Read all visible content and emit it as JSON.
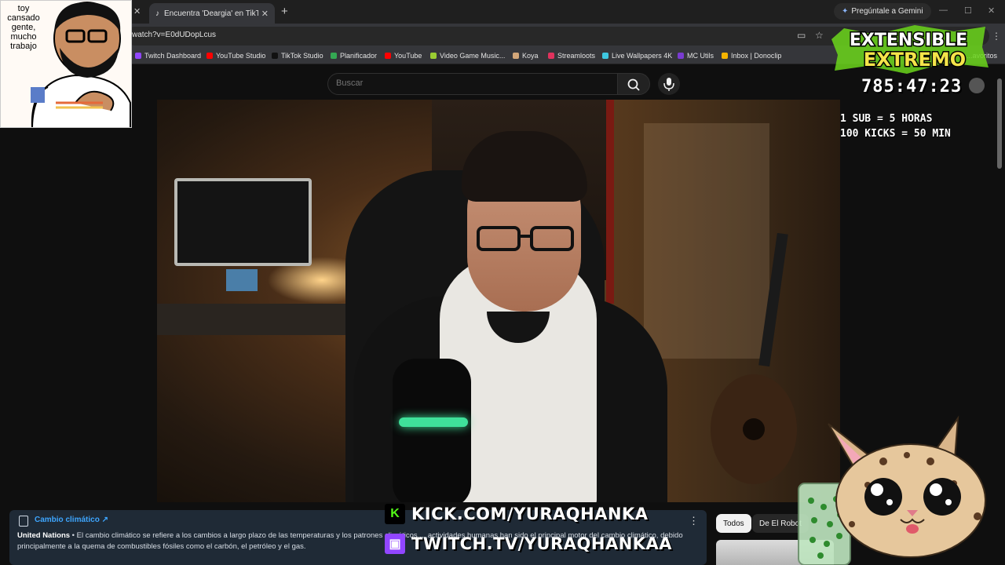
{
  "browser": {
    "active_tab_title": "Encuentra 'Deargia' en TikTok |",
    "gemini_label": "Pregúntale a Gemini",
    "url_fragment": "watch?v=E0dUDopLcus"
  },
  "bookmarks": [
    {
      "label": "Twitch Dashboard",
      "color": "#9146ff"
    },
    {
      "label": "YouTube Studio",
      "color": "#ff0000"
    },
    {
      "label": "TikTok Studio",
      "color": "#111111"
    },
    {
      "label": "Planificador",
      "color": "#34a853"
    },
    {
      "label": "YouTube",
      "color": "#ff0000"
    },
    {
      "label": "Video Game Music...",
      "color": "#9acd32"
    },
    {
      "label": "Koya",
      "color": "#d2a679"
    },
    {
      "label": "Streamloots",
      "color": "#e0325d"
    },
    {
      "label": "Live Wallpapers 4K",
      "color": "#3ec7e0"
    },
    {
      "label": "MC Utils",
      "color": "#7a3bd1"
    },
    {
      "label": "Inbox | Donoclip",
      "color": "#f5b400"
    }
  ],
  "bookmarks_end": "...avoritos",
  "youtube": {
    "search_placeholder": "Buscar"
  },
  "overlay": {
    "art_caption": "toy cansado gente, mucho trabajo",
    "logo_line1": "EXTENSIBLE",
    "logo_line2": "EXTREMO",
    "timer": "785:47:23",
    "rules": "1 SUB = 5 HORAS\n100 KICKS = 50 MIN",
    "kick_url": "KICK.COM/YURAQHANKA",
    "twitch_url": "TWITCH.TV/YURAQHANKAA"
  },
  "info_panel": {
    "title": "Cambio climático ↗",
    "source": "United Nations",
    "text": " • El cambio climático se refiere a los cambios a largo plazo de las temperaturas y los patrones climáticos ... actividades humanas han sido el principal motor del cambio climático, debido principalmente a la quema de combustibles fósiles como el carbón, el petróleo y el gas."
  },
  "chips": [
    "Todos",
    "De El Robot"
  ],
  "colors": {
    "accent_blue": "#3ea6ff",
    "kick_green": "#53fc18",
    "twitch_purple": "#9146ff",
    "mic_glow": "#3fe09a"
  }
}
